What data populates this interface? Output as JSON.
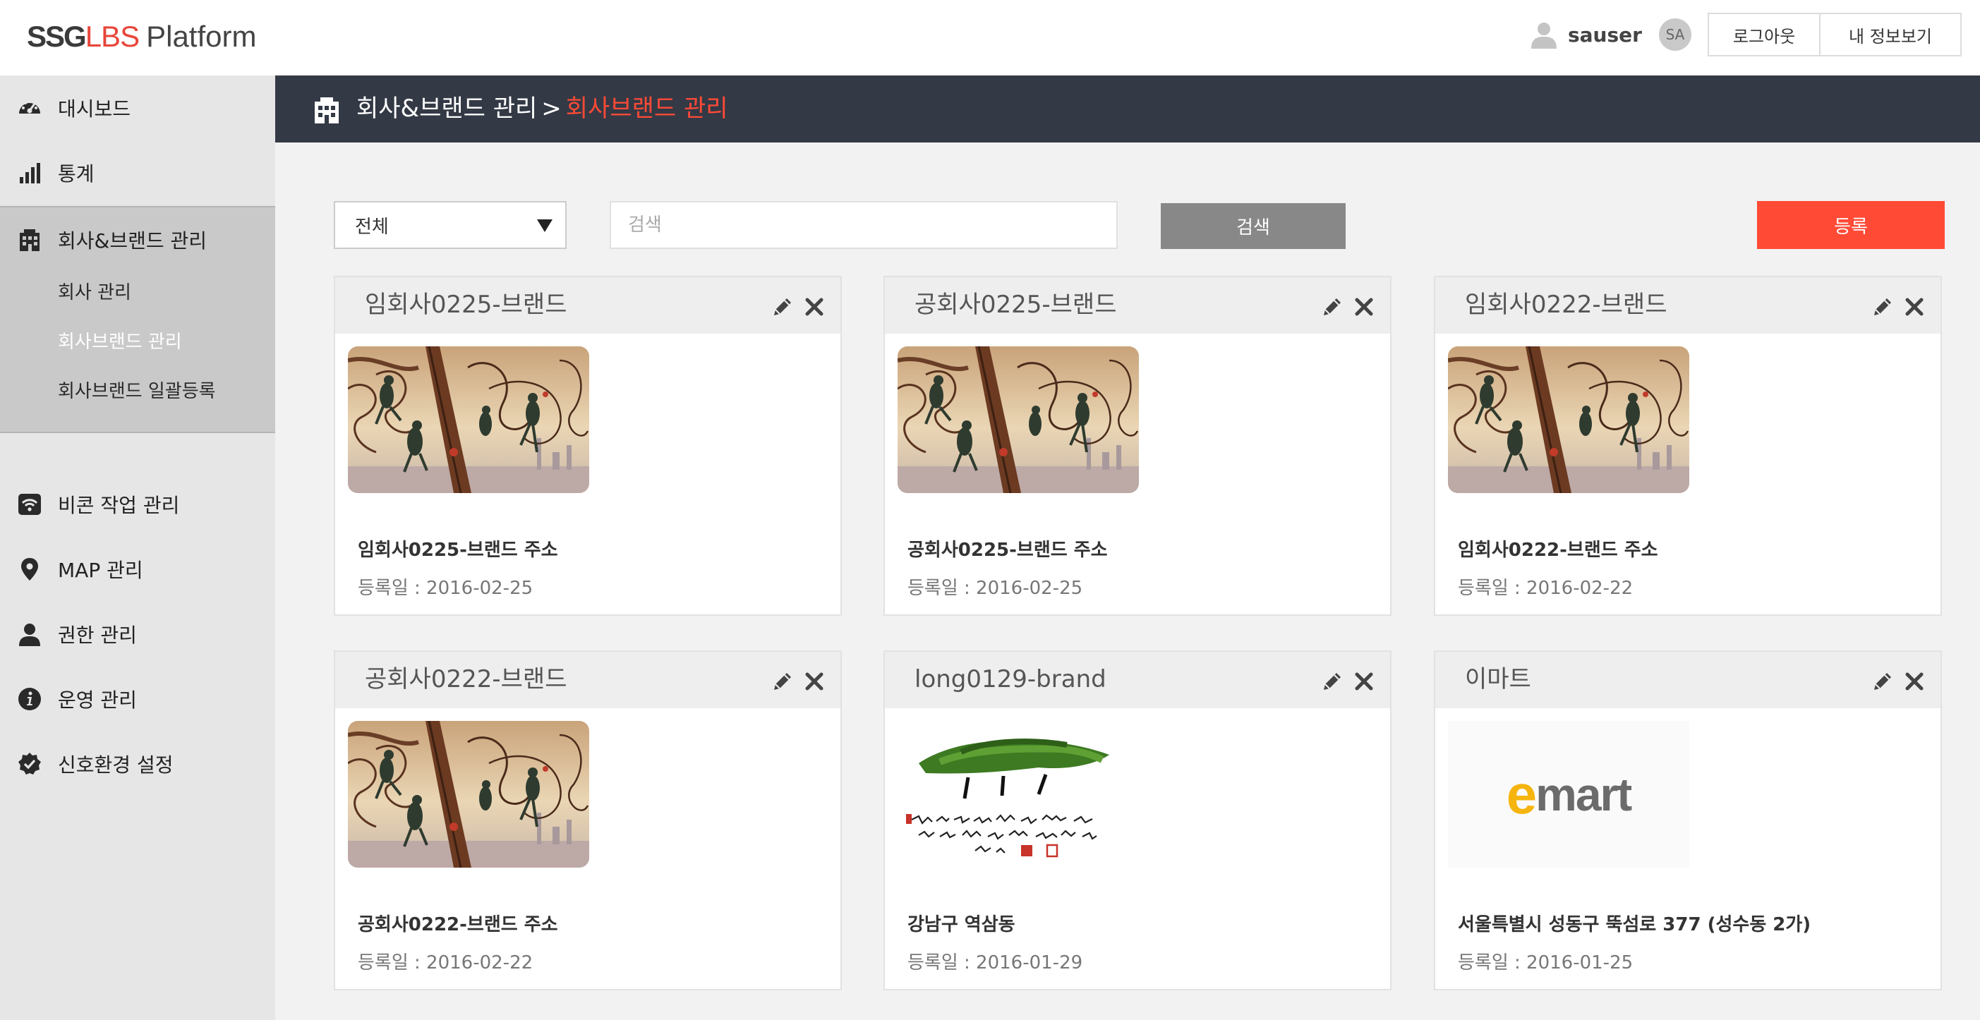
{
  "header": {
    "logo": {
      "part1": "SSG",
      "part2": "LBS",
      "part3": "Platform"
    },
    "user_name": "sauser",
    "avatar_initials": "SA",
    "logout_label": "로그아웃",
    "myinfo_label": "내 정보보기"
  },
  "sidebar": {
    "items": [
      {
        "label": "대시보드",
        "icon": "dashboard-icon"
      },
      {
        "label": "통계",
        "icon": "bar-chart-icon"
      },
      {
        "label": "회사&브랜드 관리",
        "icon": "building-icon"
      },
      {
        "label": "비콘 작업 관리",
        "icon": "wifi-icon"
      },
      {
        "label": "MAP 관리",
        "icon": "map-pin-icon"
      },
      {
        "label": "권한 관리",
        "icon": "user-icon"
      },
      {
        "label": "운영 관리",
        "icon": "info-icon"
      },
      {
        "label": "신호환경 설정",
        "icon": "shield-check-icon"
      }
    ],
    "sub_items": [
      {
        "label": "회사 관리"
      },
      {
        "label": "회사브랜드 관리"
      },
      {
        "label": "회사브랜드 일괄등록"
      }
    ]
  },
  "titlebar": {
    "parent": "회사&브랜드 관리",
    "separator": ">",
    "current": "회사브랜드 관리"
  },
  "toolbar": {
    "select_value": "전체",
    "search_placeholder": "검색",
    "search_label": "검색",
    "register_label": "등록"
  },
  "cards": [
    {
      "title": "임회사0225-브랜드",
      "address": "임회사0225-브랜드 주소",
      "date": "등록일 : 2016-02-25",
      "image": "illustration"
    },
    {
      "title": "공회사0225-브랜드",
      "address": "공회사0225-브랜드 주소",
      "date": "등록일 : 2016-02-25",
      "image": "illustration"
    },
    {
      "title": "임회사0222-브랜드",
      "address": "임회사0222-브랜드 주소",
      "date": "등록일 : 2016-02-22",
      "image": "illustration"
    },
    {
      "title": "공회사0222-브랜드",
      "address": "공회사0222-브랜드 주소",
      "date": "등록일 : 2016-02-22",
      "image": "illustration"
    },
    {
      "title": "long0129-brand",
      "address": "강남구 역삼동",
      "date": "등록일 : 2016-01-29",
      "image": "calligraphy"
    },
    {
      "title": "이마트",
      "address": "서울특별시 성동구 뚝섬로 377 (성수동 2가)",
      "date": "등록일 : 2016-01-25",
      "image": "emart",
      "logo_text": {
        "e": "e",
        "rest": "mart"
      }
    }
  ],
  "colors": {
    "accent": "#ff4a36",
    "titlebar_bg": "#333945",
    "sidebar_bg": "#e6e6e6",
    "sidebar_group_bg": "#c9c9c9",
    "search_button": "#888888",
    "emart_yellow": "#f6b40e",
    "emart_gray": "#6b6b6b"
  }
}
